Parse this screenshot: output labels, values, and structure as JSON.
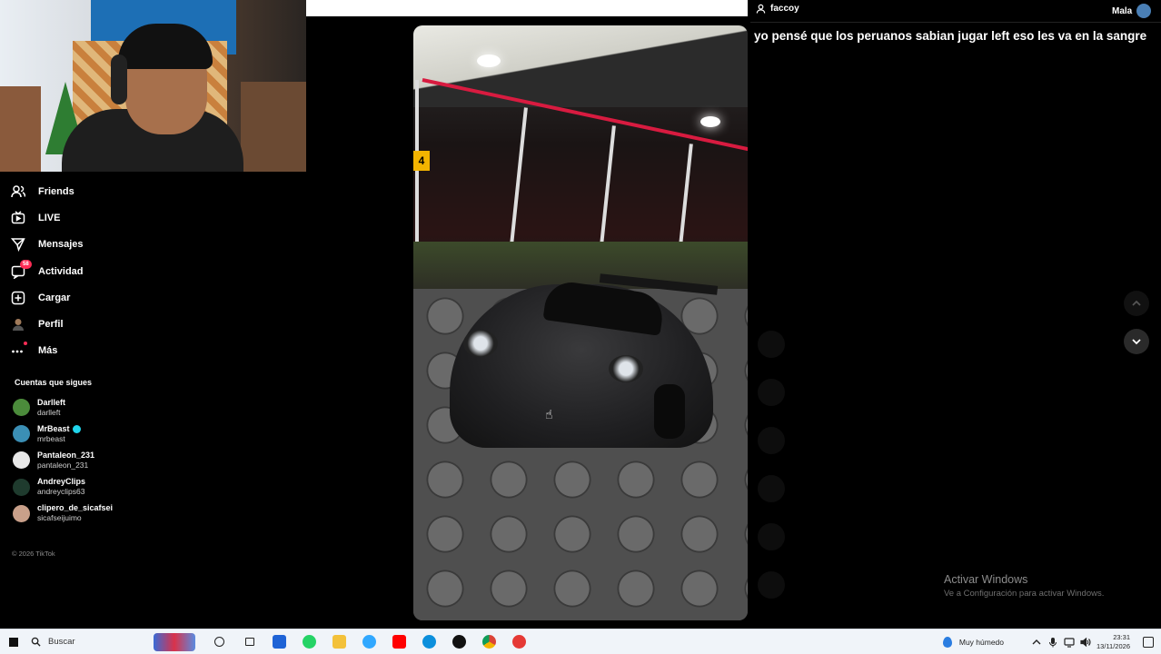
{
  "nav": {
    "items": [
      {
        "label": "Friends",
        "icon": "friends-icon"
      },
      {
        "label": "LIVE",
        "icon": "live-tv-icon"
      },
      {
        "label": "Mensajes",
        "icon": "send-icon"
      },
      {
        "label": "Actividad",
        "icon": "activity-icon",
        "badge": "58"
      },
      {
        "label": "Cargar",
        "icon": "upload-plus-icon"
      },
      {
        "label": "Perfil",
        "icon": "profile-avatar-icon"
      },
      {
        "label": "Más",
        "icon": "more-dots-icon"
      }
    ]
  },
  "following": {
    "title": "Cuentas que sigues",
    "accounts": [
      {
        "name": "Darlleft",
        "handle": "darlleft",
        "verified": false,
        "color": "#4b8b3b"
      },
      {
        "name": "MrBeast",
        "handle": "mrbeast",
        "verified": true,
        "color": "#3b8fb5"
      },
      {
        "name": "Pantaleon_231",
        "handle": "pantaleon_231",
        "verified": false,
        "color": "#e8e8e8"
      },
      {
        "name": "AndreyClips",
        "handle": "andreyclips63",
        "verified": false,
        "color": "#1f3b2e"
      },
      {
        "name": "clipero_de_sicafsei",
        "handle": "sicafseijuimo",
        "verified": false,
        "color": "#c9a08a"
      }
    ]
  },
  "copyright": "© 2026 TikTok",
  "header": {
    "user": "faccoy",
    "right_label": "Mala"
  },
  "caption": "yo pensé que los peruanos sabian jugar left eso les va en la sangre",
  "video": {
    "sign_number": "4"
  },
  "watermark": {
    "line1": "Activar Windows",
    "line2": "Ve a Configuración para activar Windows."
  },
  "taskbar": {
    "search_placeholder": "Buscar",
    "weather": "Muy húmedo",
    "time": "23:31",
    "date": "13/11/2026",
    "apps": [
      {
        "name": "cortana-circle-icon",
        "color": "#ffffff"
      },
      {
        "name": "task-view-icon",
        "color": "#ffffff"
      },
      {
        "name": "mail-icon",
        "color": "#1e63d6"
      },
      {
        "name": "whatsapp-icon",
        "color": "#25d366"
      },
      {
        "name": "file-explorer-icon",
        "color": "#f3c13a"
      },
      {
        "name": "photoshop-icon",
        "color": "#31a8ff"
      },
      {
        "name": "youtube-icon",
        "color": "#ff0000"
      },
      {
        "name": "edge-icon",
        "color": "#0c8fdc"
      },
      {
        "name": "capcut-icon",
        "color": "#111111"
      },
      {
        "name": "chrome-icon",
        "color": "#db4437"
      },
      {
        "name": "chrome-alt-icon",
        "color": "#e53935"
      }
    ]
  },
  "colors": {
    "accent": "#fe2c55",
    "verified": "#20d5ec",
    "background": "#000000"
  }
}
